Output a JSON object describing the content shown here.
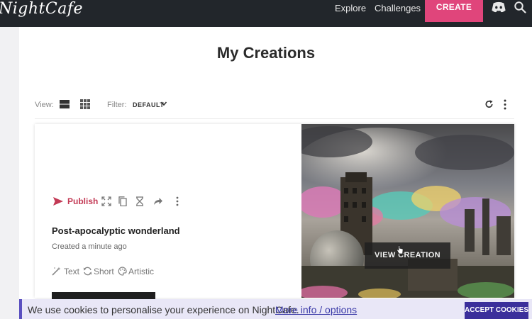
{
  "header": {
    "logo_text": "NightCafe",
    "nav": {
      "explore": "Explore",
      "challenges": "Challenges"
    },
    "create_label": "CREATE",
    "icons": [
      "discord-icon",
      "search-icon"
    ],
    "accent_color": "#e0457b"
  },
  "page": {
    "title": "My Creations",
    "toolbar": {
      "view_label": "View:",
      "filter_label": "Filter:",
      "filter_value": "DEFAULT"
    }
  },
  "creation": {
    "publish_label": "Publish",
    "title": "Post-apocalyptic wonderland",
    "created": "Created a minute ago",
    "tags": {
      "type": "Text",
      "length": "Short",
      "style": "Artistic"
    },
    "view_label": "VIEW CREATION"
  },
  "cookie_bar": {
    "text": "We use cookies to personalise your experience on NightCafe.",
    "link_text": "More info / options",
    "accept_label": "ACCEPT COOKIES",
    "accent_color": "#3b2f9b"
  }
}
